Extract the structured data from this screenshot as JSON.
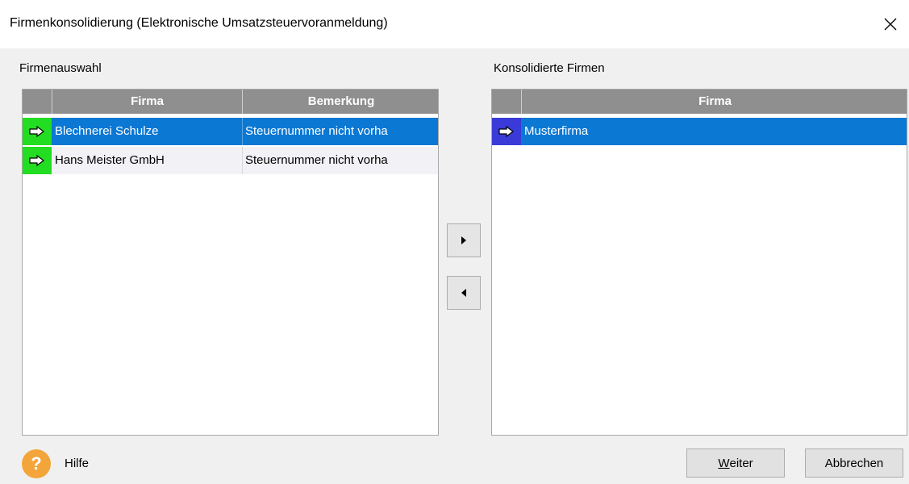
{
  "window": {
    "title": "Firmenkonsolidierung (Elektronische Umsatzsteuervoranmeldung)",
    "close_icon": "close-icon"
  },
  "left_panel": {
    "label": "Firmenauswahl",
    "columns": [
      "Firma",
      "Bemerkung"
    ],
    "rows": [
      {
        "firma": "Blechnerei Schulze",
        "bemerkung": "Steuernummer nicht vorha",
        "selected": true
      },
      {
        "firma": "Hans Meister GmbH",
        "bemerkung": "Steuernummer nicht vorha",
        "selected": false
      }
    ],
    "indicator_color": "#22dd22"
  },
  "right_panel": {
    "label": "Konsolidierte Firmen",
    "columns": [
      "Firma"
    ],
    "rows": [
      {
        "firma": "Musterfirma",
        "selected": true
      }
    ],
    "indicator_color": "#3a3ad8"
  },
  "move_buttons": {
    "add_icon": "triangle-right-icon",
    "remove_icon": "triangle-left-icon"
  },
  "footer": {
    "help_label": "Hilfe",
    "help_icon_text": "?",
    "next_button_mnemonic": "W",
    "next_button_rest": "eiter",
    "cancel_button": "Abbrechen"
  },
  "colors": {
    "selection": "#0b78d4",
    "header": "#8f8f8f",
    "help": "#f3a53a"
  }
}
